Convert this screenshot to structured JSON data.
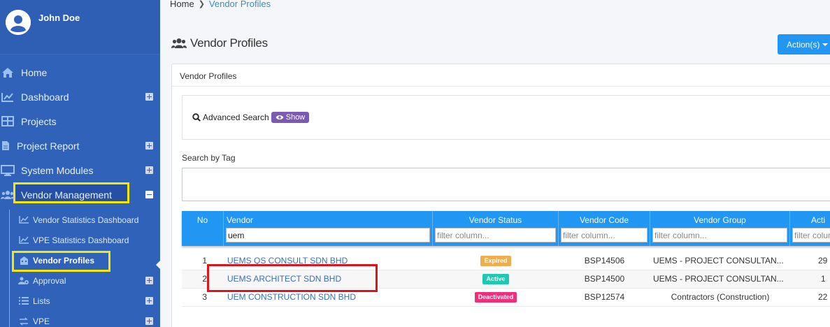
{
  "user": {
    "name": "John Doe"
  },
  "sidebar": {
    "items": [
      {
        "label": "Home",
        "icon": "home-icon",
        "expandable": false
      },
      {
        "label": "Dashboard",
        "icon": "chart-line-icon",
        "expandable": true
      },
      {
        "label": "Projects",
        "icon": "table-icon",
        "expandable": false
      },
      {
        "label": "Project Report",
        "icon": "file-icon",
        "expandable": true
      },
      {
        "label": "System Modules",
        "icon": "desktop-icon",
        "expandable": true
      },
      {
        "label": "Vendor Management",
        "icon": "users-icon",
        "expandable": true,
        "expanded": true
      }
    ],
    "sub_items": [
      {
        "label": "Vendor Statistics Dashboard",
        "icon": "chart-line-icon"
      },
      {
        "label": "VPE Statistics Dashboard",
        "icon": "chart-line-icon"
      },
      {
        "label": "Vendor Profiles",
        "icon": "building-icon",
        "active": true
      },
      {
        "label": "Approval",
        "icon": "users-cog-icon",
        "expandable": true
      },
      {
        "label": "Lists",
        "icon": "list-icon",
        "expandable": true
      },
      {
        "label": "VPE",
        "icon": "exchange-icon",
        "expandable": true
      }
    ]
  },
  "breadcrumb": {
    "home": "Home",
    "current": "Vendor Profiles"
  },
  "page": {
    "title": "Vendor Profiles",
    "action_label": "Action(s)"
  },
  "card": {
    "title": "Vendor Profiles",
    "advanced_search_label": "Advanced Search",
    "show_label": "Show",
    "search_by_tag_label": "Search by Tag"
  },
  "table": {
    "columns": [
      "No",
      "Vendor",
      "Vendor Status",
      "Vendor Code",
      "Vendor Group",
      "Acti"
    ],
    "filters": {
      "vendor_value": "uem",
      "placeholder": "filter column..."
    },
    "rows": [
      {
        "no": "1",
        "vendor": "UEMS QS CONSULT SDN BHD",
        "status": "Expired",
        "code": "BSP14506",
        "group": "UEMS - PROJECT CONSULTAN...",
        "active": "29"
      },
      {
        "no": "2",
        "vendor": "UEMS ARCHITECT SDN BHD",
        "status": "Active",
        "code": "BSP14500",
        "group": "UEMS - PROJECT CONSULTAN...",
        "active": "1"
      },
      {
        "no": "3",
        "vendor": "UEM CONSTRUCTION SDN BHD",
        "status": "Deactivated",
        "code": "BSP12574",
        "group": "Contractors (Construction)",
        "active": "22"
      }
    ]
  },
  "colors": {
    "sidebar": "#2f62b8",
    "table_header": "#2196f3",
    "expired": "#f0ad4e",
    "active": "#1fc8b1",
    "deactivated": "#ef2f7c",
    "highlight_yellow": "#f5e900",
    "highlight_red": "#e0121c"
  }
}
